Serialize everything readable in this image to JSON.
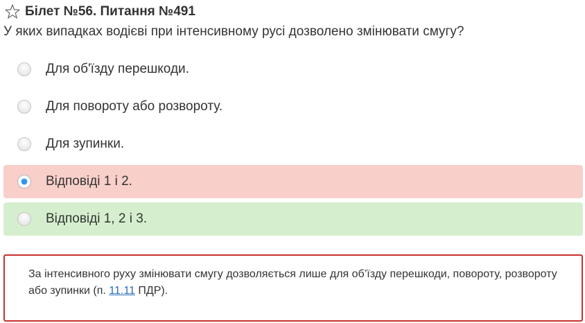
{
  "header": {
    "title": "Білет №56. Питання №491",
    "star_icon": "star-outline-icon"
  },
  "question": {
    "text": "У яких випадках водієві при інтенсивному русі дозволено змінювати смугу?"
  },
  "answers": [
    {
      "label": "Для об'їзду перешкоди.",
      "state": "none",
      "selected": false
    },
    {
      "label": "Для повороту або розвороту.",
      "state": "none",
      "selected": false
    },
    {
      "label": "Для зупинки.",
      "state": "none",
      "selected": false
    },
    {
      "label": "Відповіді 1 і 2.",
      "state": "wrong",
      "selected": true
    },
    {
      "label": "Відповіді 1, 2 і 3.",
      "state": "correct",
      "selected": false
    }
  ],
  "explanation": {
    "text_before": "За інтенсивного руху змінювати смугу дозволяється лише для об’їзду перешкоди, повороту, розвороту або зупинки (п. ",
    "link_text": "11.11",
    "text_after": " ПДР)."
  },
  "colors": {
    "wrong_bg": "#f8cfc9",
    "correct_bg": "#d5efce",
    "explanation_border": "#c9302c",
    "link": "#2a6ebb"
  }
}
